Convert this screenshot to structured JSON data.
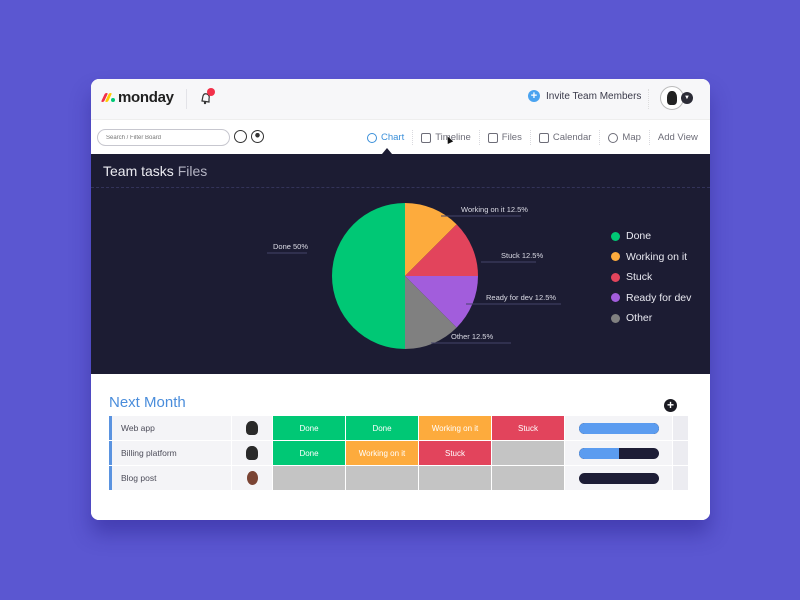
{
  "app": {
    "logo_text": "monday",
    "logo_colors": [
      "#f2314a",
      "#ffcb00",
      "#00c875"
    ],
    "notification_badge_color": "#f2314a",
    "invite_label": "Invite Team Members"
  },
  "toolbar": {
    "search_placeholder": "Search / Filter Board",
    "views": [
      {
        "label": "Chart",
        "icon": "pie-chart-icon",
        "active": true
      },
      {
        "label": "Timeline",
        "icon": "timeline-icon",
        "active": false
      },
      {
        "label": "Files",
        "icon": "files-icon",
        "active": false
      },
      {
        "label": "Calendar",
        "icon": "calendar-icon",
        "active": false
      },
      {
        "label": "Map",
        "icon": "map-pin-icon",
        "active": false
      },
      {
        "label": "Add View",
        "icon": "",
        "active": false
      }
    ]
  },
  "chart_panel": {
    "title": "Team tasks",
    "subtitle": "Files"
  },
  "chart_data": {
    "type": "pie",
    "title": "Team tasks Files",
    "slices": [
      {
        "label": "Done",
        "value": 50,
        "display": "Done 50%",
        "color": "#00c875"
      },
      {
        "label": "Working on it",
        "value": 12.5,
        "display": "Working on it 12.5%",
        "color": "#fdab3d"
      },
      {
        "label": "Stuck",
        "value": 12.5,
        "display": "Stuck 12.5%",
        "color": "#e2445c"
      },
      {
        "label": "Ready for dev",
        "value": 12.5,
        "display": "Ready for dev 12.5%",
        "color": "#a25ddc"
      },
      {
        "label": "Other",
        "value": 12.5,
        "display": "Other 12.5%",
        "color": "#808080"
      }
    ],
    "legend": [
      "Done",
      "Working on it",
      "Stuck",
      "Ready for dev",
      "Other"
    ],
    "legend_position": "right"
  },
  "board": {
    "group_title": "Next Month",
    "status_colors": {
      "Done": "#00c875",
      "Working on it": "#fdab3d",
      "Stuck": "#e2445c",
      "": "#c4c4c4"
    },
    "rows": [
      {
        "name": "Web app",
        "person": "male",
        "statuses": [
          "Done",
          "Done",
          "Working on it",
          "Stuck"
        ],
        "progress": 100
      },
      {
        "name": "Billing platform",
        "person": "male",
        "statuses": [
          "Done",
          "Working on it",
          "Stuck",
          ""
        ],
        "progress": 50
      },
      {
        "name": "Blog post",
        "person": "female",
        "statuses": [
          "",
          "",
          "",
          ""
        ],
        "progress": 0
      }
    ]
  }
}
